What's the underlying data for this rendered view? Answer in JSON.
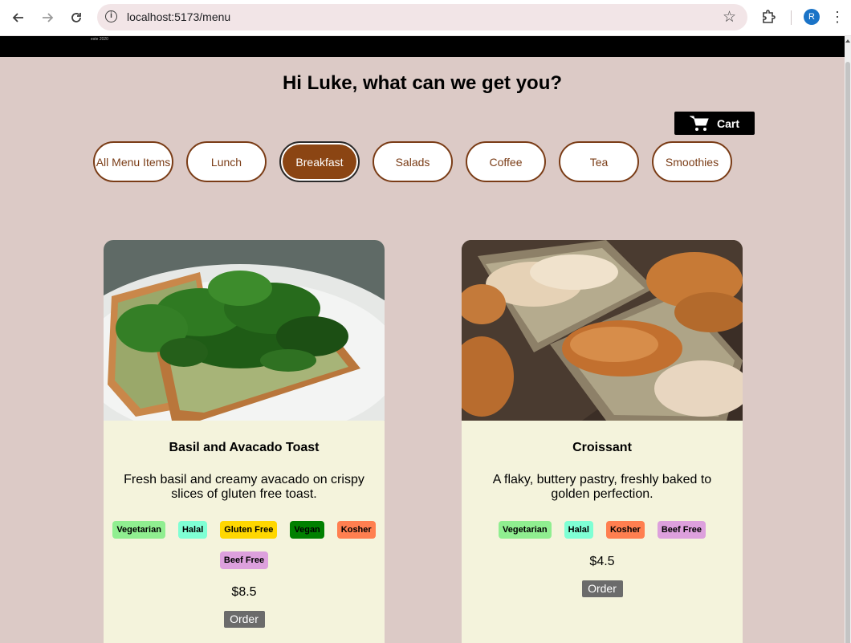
{
  "browser": {
    "url": "localhost:5173/menu",
    "profile_initial": "R"
  },
  "header": {
    "logo_text": "este 2020"
  },
  "greeting": "Hi Luke, what can we get you?",
  "cart": {
    "label": "Cart"
  },
  "filters": [
    {
      "label": "All Menu Items",
      "active": false
    },
    {
      "label": "Lunch",
      "active": false
    },
    {
      "label": "Breakfast",
      "active": true
    },
    {
      "label": "Salads",
      "active": false
    },
    {
      "label": "Coffee",
      "active": false
    },
    {
      "label": "Tea",
      "active": false
    },
    {
      "label": "Smoothies",
      "active": false
    }
  ],
  "colors": {
    "accent": "#8b4513",
    "page_bg": "#dccac6",
    "card_bg": "#f4f3dc",
    "vegetarian": "#90ee90",
    "halal": "#7fffd4",
    "gluten_free": "#ffd700",
    "vegan": "#008000",
    "kosher": "#ff7f50",
    "beef_free": "#dda0dd"
  },
  "items": [
    {
      "name": "Basil and Avacado Toast",
      "description": "Fresh basil and creamy avacado on crispy slices of gluten free toast.",
      "tags": [
        "Vegetarian",
        "Halal",
        "Gluten Free",
        "Vegan",
        "Kosher",
        "Beef Free"
      ],
      "price": "$8.5",
      "order_label": "Order",
      "image": "avocado-toast-photo"
    },
    {
      "name": "Croissant",
      "description": "A flaky, buttery pastry, freshly baked to golden perfection.",
      "tags": [
        "Vegetarian",
        "Halal",
        "Kosher",
        "Beef Free"
      ],
      "price": "$4.5",
      "order_label": "Order",
      "image": "croissant-photo"
    }
  ]
}
